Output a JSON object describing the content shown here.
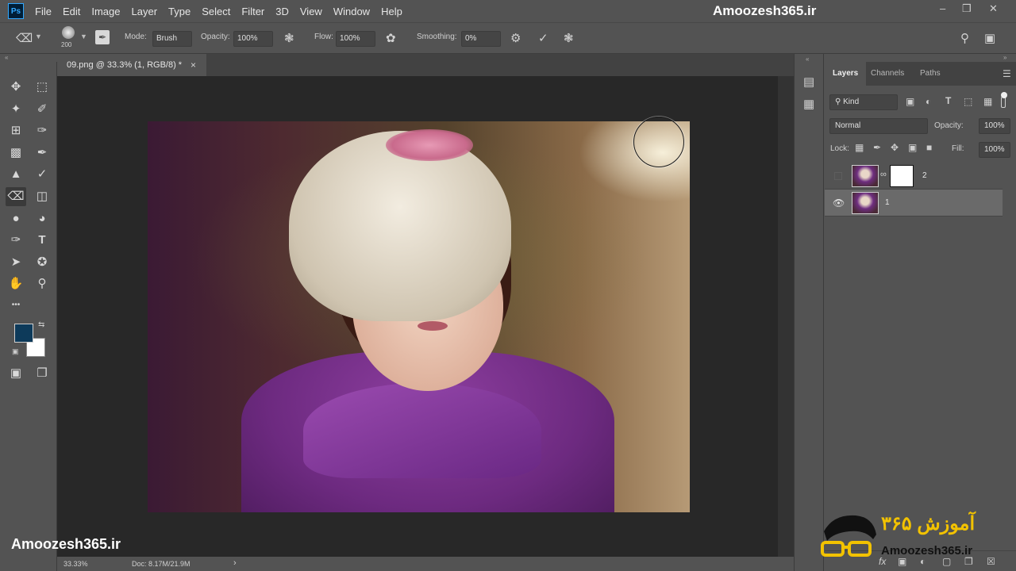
{
  "menubar": {
    "logo": "Ps",
    "items": [
      "File",
      "Edit",
      "Image",
      "Layer",
      "Type",
      "Select",
      "Filter",
      "3D",
      "View",
      "Window",
      "Help"
    ],
    "brand": "Amoozesh365.ir",
    "window_controls": [
      "‒",
      "❒",
      "✕"
    ]
  },
  "options": {
    "brush_size": "200",
    "mode_label": "Mode:",
    "mode_value": "Brush",
    "opacity_label": "Opacity:",
    "opacity_value": "100%",
    "flow_label": "Flow:",
    "flow_value": "100%",
    "smoothing_label": "Smoothing:",
    "smoothing_value": "0%"
  },
  "document": {
    "tab_title": "09.png @ 33.3% (1, RGB/8) *",
    "close": "×",
    "zoom": "33.33%",
    "doc_info": "Doc: 8.17M/21.9M",
    "status_arrow": "›"
  },
  "tools": {
    "foreground_color": "#0d3a5a",
    "background_color": "#ffffff",
    "more": "•••"
  },
  "layers_panel": {
    "tabs": [
      "Layers",
      "Channels",
      "Paths"
    ],
    "filter_kind": "Kind",
    "blend_mode": "Normal",
    "opacity_label": "Opacity:",
    "opacity_value": "100%",
    "lock_label": "Lock:",
    "fill_label": "Fill:",
    "fill_value": "100%",
    "layers": [
      {
        "name": "2",
        "visible": false,
        "has_mask": true,
        "selected": false
      },
      {
        "name": "1",
        "visible": true,
        "has_mask": false,
        "selected": true
      }
    ],
    "footer_icons": [
      "fx",
      "▣",
      "◐",
      "▢",
      "❐",
      "☒"
    ]
  },
  "watermark": {
    "left_text": "Amoozesh365.ir",
    "logo_text_fa": "آموزش ۳۶۵",
    "logo_text_en": "Amoozesh365.ir"
  },
  "colors": {
    "ui_bg": "#535353",
    "pasteboard": "#282828",
    "accent_ps": "#31a8ff"
  }
}
